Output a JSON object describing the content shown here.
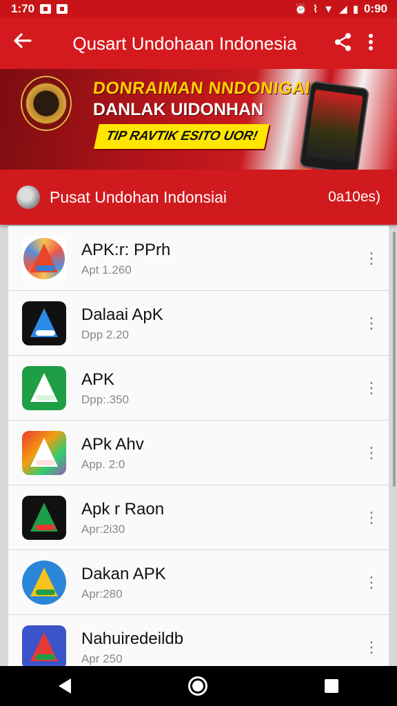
{
  "status_bar": {
    "time": "1:70",
    "right_time": "0:90"
  },
  "app_bar": {
    "title": "Qusart Undohaan Indonesia"
  },
  "banner": {
    "line1": "DONRAIMAN NNDONIGAI!",
    "line2": "DANLAK UIDONHAN",
    "ribbon": "TIP RAVTIK ESITO UOR!"
  },
  "section": {
    "title": "Pusat Undohan Indonsiai",
    "count": "0a10es)"
  },
  "apps": [
    {
      "title": "APK:r: PPrh",
      "subtitle": "Apt 1.260",
      "icon": "apk-burst-icon"
    },
    {
      "title": "Dalaai ApK",
      "subtitle": "Dpp 2.20",
      "icon": "apk-dark-icon"
    },
    {
      "title": "APK",
      "subtitle": "Dpp:.350",
      "icon": "apk-green-icon"
    },
    {
      "title": "APk Ahv",
      "subtitle": "App. 2:0",
      "icon": "apk-gradient-icon"
    },
    {
      "title": "Apk r Raon",
      "subtitle": "Apr:2i30",
      "icon": "apk-black-icon"
    },
    {
      "title": "Dakan APK",
      "subtitle": "Apr:280",
      "icon": "apk-blue-circle-icon"
    },
    {
      "title": "Nahuiredeildb",
      "subtitle": "Apr 250",
      "icon": "apk-blue-icon"
    }
  ],
  "colors": {
    "primary": "#d51a1f",
    "statusbar": "#c81418",
    "list_bg": "#fafafa"
  }
}
